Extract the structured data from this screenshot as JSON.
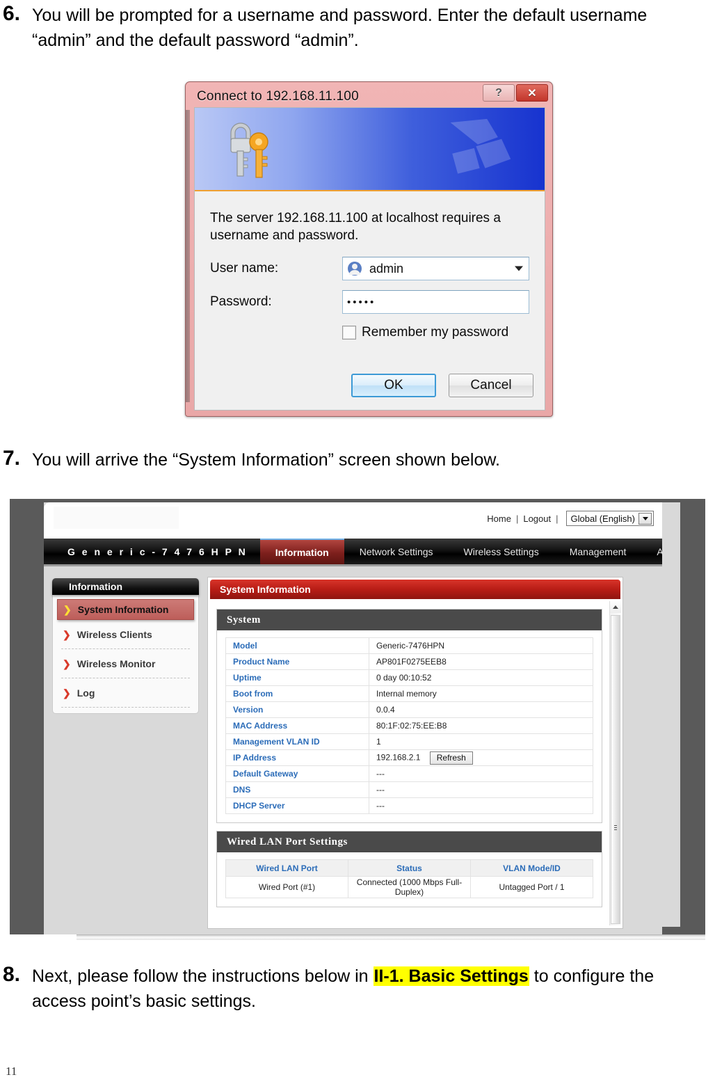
{
  "document": {
    "page_number": "11",
    "steps": [
      {
        "number": "6.",
        "text": "You will be prompted for a username and password. Enter the default username “admin” and the default password “admin”."
      },
      {
        "number": "7.",
        "text": "You will arrive the “System Information” screen shown below."
      },
      {
        "number": "8.",
        "text_before": "Next, please follow the instructions below in ",
        "highlight": "II-1. Basic Settings",
        "text_after": " to configure the access point’s basic settings."
      }
    ]
  },
  "auth_dialog": {
    "title": "Connect to 192.168.11.100",
    "help_button": "?",
    "close_button": "✕",
    "message": "The server 192.168.11.100 at localhost requires a username and password.",
    "username_label": "User name:",
    "username_value": "admin",
    "password_label": "Password:",
    "password_value": "•••••",
    "remember_label": "Remember my password",
    "ok_label": "OK",
    "cancel_label": "Cancel",
    "accent_border": "#c23a30",
    "banner_gradient_start": "#b9c8f5",
    "banner_gradient_end": "#1733cf"
  },
  "webui": {
    "topbar": {
      "home_label": "Home",
      "logout_label": "Logout",
      "separator": "|",
      "language_value": "Global (English)"
    },
    "mainnav": {
      "brand": "G e n e r i c - 7 4 7 6 H P N",
      "items": [
        {
          "label": "Information",
          "active": true
        },
        {
          "label": "Network Settings",
          "active": false
        },
        {
          "label": "Wireless Settings",
          "active": false
        },
        {
          "label": "Management",
          "active": false
        },
        {
          "label": "Advanced",
          "active": false
        }
      ],
      "active_color": "#8e211c"
    },
    "sidebar": {
      "header": "Information",
      "items": [
        {
          "label": "System Information",
          "active": true
        },
        {
          "label": "Wireless Clients",
          "active": false
        },
        {
          "label": "Wireless Monitor",
          "active": false
        },
        {
          "label": "Log",
          "active": false
        }
      ]
    },
    "panel": {
      "title": "System Information",
      "system_card": {
        "heading": "System",
        "rows": [
          {
            "key": "Model",
            "value": "Generic-7476HPN"
          },
          {
            "key": "Product Name",
            "value": "AP801F0275EEB8"
          },
          {
            "key": "Uptime",
            "value": " 0 day 00:10:52"
          },
          {
            "key": "Boot from",
            "value": "Internal memory"
          },
          {
            "key": "Version",
            "value": "0.0.4"
          },
          {
            "key": "MAC Address",
            "value": "80:1F:02:75:EE:B8"
          },
          {
            "key": "Management VLAN ID",
            "value": "1"
          },
          {
            "key": "IP Address",
            "value": "192.168.2.1"
          },
          {
            "key": "Default Gateway",
            "value": "---"
          },
          {
            "key": "DNS",
            "value": "---"
          },
          {
            "key": "DHCP Server",
            "value": "---"
          }
        ],
        "refresh_label": "Refresh"
      },
      "lan_card": {
        "heading": "Wired LAN Port Settings",
        "columns": [
          "Wired LAN Port",
          "Status",
          "VLAN Mode/ID"
        ],
        "rows": [
          [
            "Wired Port (#1)",
            "Connected (1000 Mbps Full-Duplex)",
            "Untagged Port  /   1"
          ]
        ]
      }
    }
  }
}
